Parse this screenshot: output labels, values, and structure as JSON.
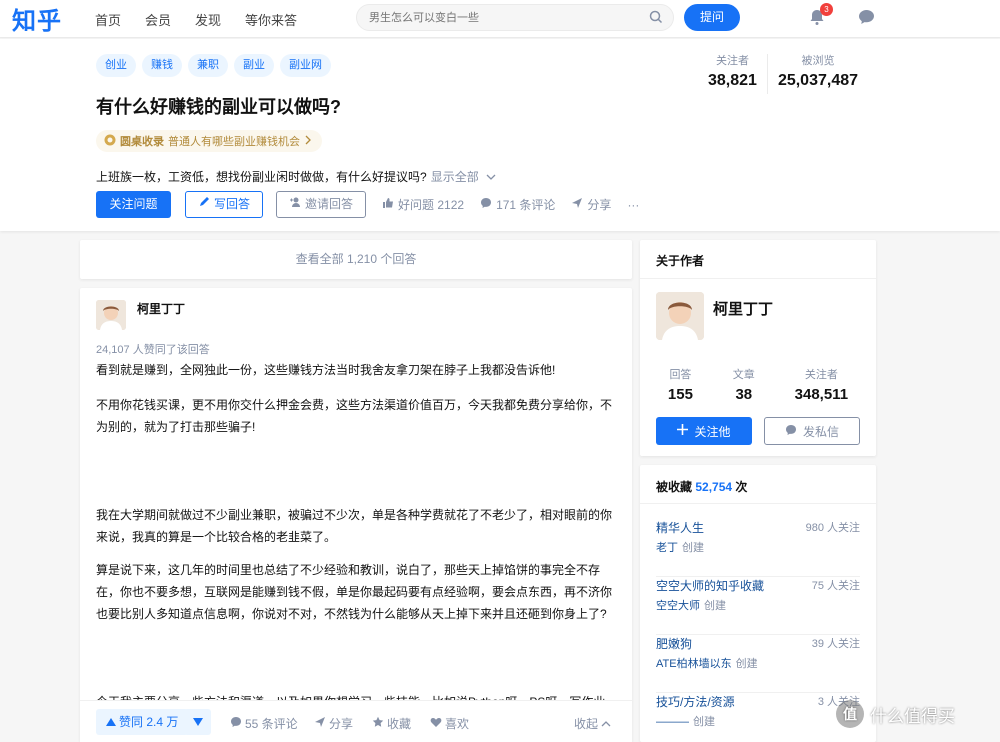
{
  "brand": {
    "logo": "知乎",
    "accent": "#1772f6"
  },
  "nav": {
    "items": [
      "首页",
      "会员",
      "发现",
      "等你来答"
    ]
  },
  "search": {
    "placeholder": "男生怎么可以变白一些"
  },
  "header": {
    "ask_label": "提问",
    "notification_count": "3"
  },
  "question": {
    "topics": [
      "创业",
      "赚钱",
      "兼职",
      "副业",
      "副业网"
    ],
    "title": "有什么好赚钱的副业可以做吗?",
    "roundtable_label": "圆桌收录",
    "roundtable_title": "普通人有哪些副业赚钱机会",
    "description": "上班族一枚，工资低，想找份副业闲时做做，有什么好提议吗?",
    "show_all": "显示全部",
    "follow_btn": "关注问题",
    "write_btn": "写回答",
    "invite_btn": "邀请回答",
    "good_question": "好问题 2122",
    "comments": "171 条评论",
    "share": "分享",
    "more": "···",
    "stats": {
      "followers_label": "关注者",
      "followers": "38,821",
      "views_label": "被浏览",
      "views": "25,037,487"
    }
  },
  "answers": {
    "view_all": "查看全部 1,210 个回答"
  },
  "answer": {
    "author": "柯里丁丁",
    "vote_text": "24,107 人赞同了该回答",
    "paragraphs": [
      "看到就是赚到，全网独此一份，这些赚钱方法当时我舍友拿刀架在脖子上我都没告诉他!",
      "不用你花钱买课，更不用你交什么押金会费，这些方法渠道价值百万，今天我都免费分享给你，不为别的，就为了打击那些骗子!",
      "我在大学期间就做过不少副业兼职，被骗过不少次，单是各种学费就花了不老少了，相对眼前的你来说，我真的算是一个比较合格的老韭菜了。",
      "算是说下来，这几年的时间里也总结了不少经验和教训，说白了，那些天上掉馅饼的事完全不存在，你也不要多想，互联网是能赚到钱不假，单是你最起码要有点经验啊，要会点东西，再不济你也要比别人多知道点信息啊，你说对不对，不然钱为什么能够从天上掉下来并且还砸到你身上了?",
      "今天我主要分享一些方法和渠道，以及如果你想学习一些技能，比如说Python呀、PS呀、写作业、"
    ],
    "actions": {
      "upvote": "赞同 2.4 万",
      "comments": "55 条评论",
      "share": "分享",
      "collect": "收藏",
      "like": "喜欢",
      "collapse": "收起"
    }
  },
  "about_author": {
    "title": "关于作者",
    "name": "柯里丁丁",
    "answers_label": "回答",
    "answers": "155",
    "articles_label": "文章",
    "articles": "38",
    "followers_label": "关注者",
    "followers": "348,511",
    "follow_btn": "关注他",
    "message_btn": "发私信"
  },
  "collections": {
    "title_prefix": "被收藏",
    "count": "52,754",
    "title_suffix": "次",
    "created_label": "创建",
    "items": [
      {
        "name": "精华人生",
        "creator": "老丁",
        "followers": "980 人关注"
      },
      {
        "name": "空空大师的知乎收藏",
        "creator": "空空大师",
        "followers": "75 人关注"
      },
      {
        "name": "肥嫩狗",
        "creator": "ATE柏林墙以东",
        "followers": "39 人关注"
      },
      {
        "name": "技巧/方法/资源",
        "creator": "———",
        "followers": "3 人关注"
      }
    ]
  },
  "watermark": {
    "symbol": "值",
    "text": "什么值得买"
  }
}
